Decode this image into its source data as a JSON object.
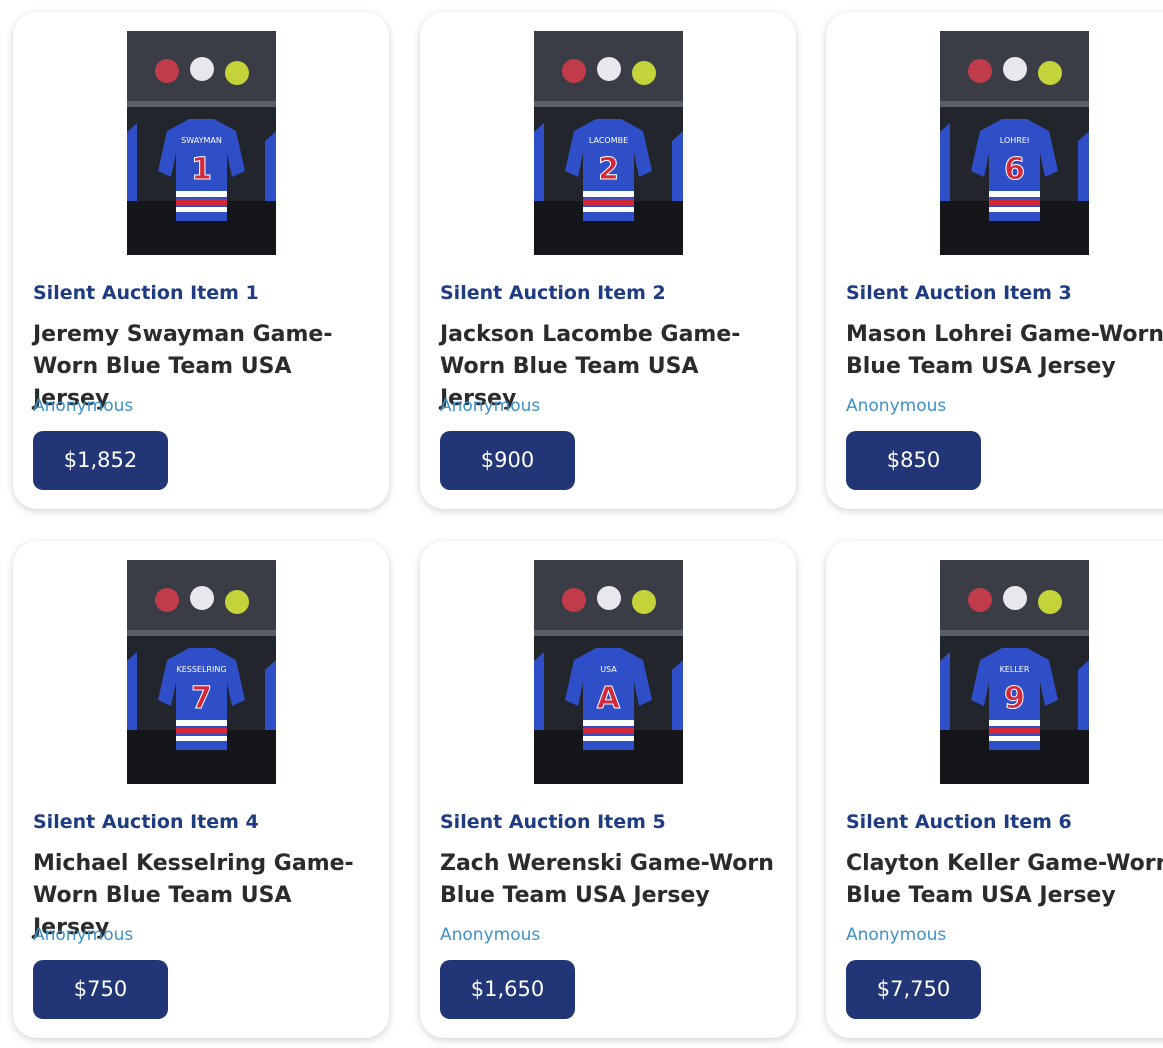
{
  "items": [
    {
      "label": "Silent Auction Item 1",
      "title": "Jeremy Swayman Game-Worn Blue Team USA Jersey",
      "bidder": "Anonymous",
      "bid": "$1,852",
      "jersey_name": "SWAYMAN",
      "jersey_number": "1"
    },
    {
      "label": "Silent Auction Item 2",
      "title": "Jackson Lacombe Game-Worn Blue Team USA Jersey",
      "bidder": "Anonymous",
      "bid": "$900",
      "jersey_name": "LACOMBE",
      "jersey_number": "2"
    },
    {
      "label": "Silent Auction Item 3",
      "title": "Mason Lohrei Game-Worn Blue Team USA Jersey",
      "bidder": "Anonymous",
      "bid": "$850",
      "jersey_name": "LOHREI",
      "jersey_number": "6"
    },
    {
      "label": "Silent Auction Item 4",
      "title": "Michael Kesselring Game-Worn Blue Team USA Jersey",
      "bidder": "Anonymous",
      "bid": "$750",
      "jersey_name": "KESSELRING",
      "jersey_number": "7"
    },
    {
      "label": "Silent Auction Item 5",
      "title": "Zach Werenski Game-Worn Blue Team USA Jersey",
      "bidder": "Anonymous",
      "bid": "$1,650",
      "jersey_name": "USA",
      "jersey_number": "A"
    },
    {
      "label": "Silent Auction Item 6",
      "title": "Clayton Keller Game-Worn Blue Team USA Jersey",
      "bidder": "Anonymous",
      "bid": "$7,750",
      "jersey_name": "KELLER",
      "jersey_number": "9"
    }
  ],
  "colors": {
    "brand_navy": "#213577",
    "label_blue": "#1f3b82",
    "bidder_blue": "#3e91c9",
    "jersey_blue": "#2f4fc9",
    "stripe_red": "#d2283a"
  },
  "icons": {
    "photo": "jersey-photo"
  }
}
